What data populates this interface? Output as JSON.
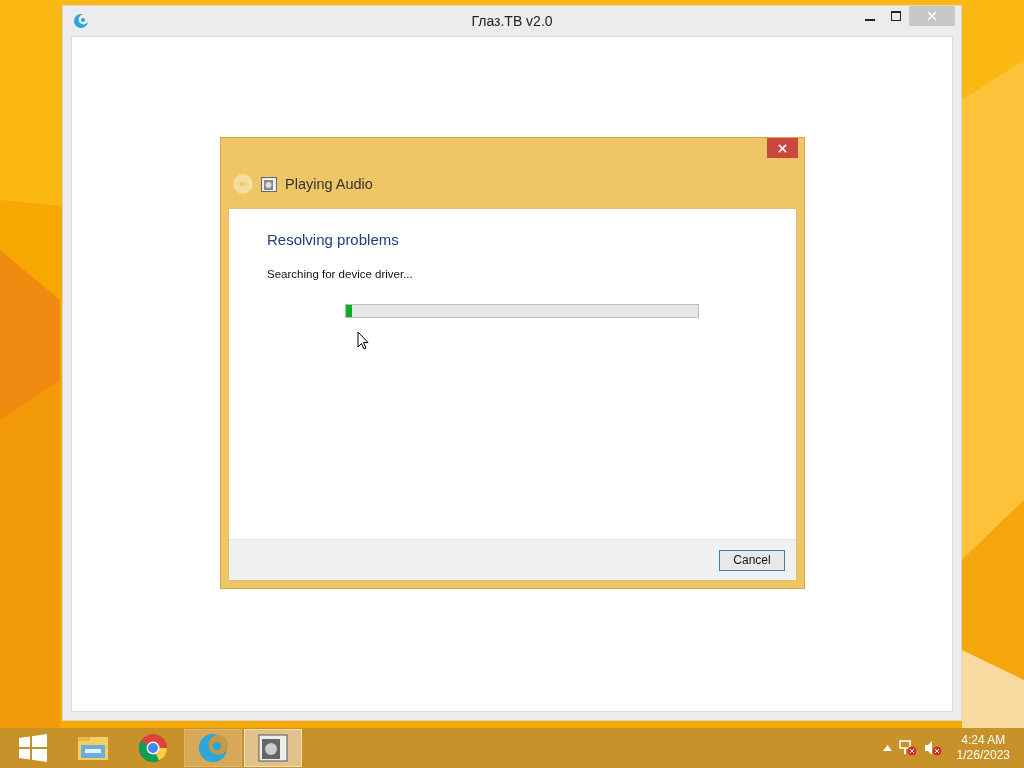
{
  "app_window": {
    "title": "Глаз.ТВ v2.0"
  },
  "dialog": {
    "title": "Playing Audio",
    "heading": "Resolving problems",
    "status": "Searching for device driver...",
    "progress": {
      "level": 0.018
    },
    "buttons": [
      {
        "label": "Cancel"
      }
    ]
  },
  "taskbar": {
    "items": [
      {
        "kind": "start",
        "selected": false
      },
      {
        "kind": "folder",
        "selected": false
      },
      {
        "kind": "chrome",
        "selected": false
      },
      {
        "kind": "app",
        "selected": false
      },
      {
        "kind": "troubleshooter",
        "selected": true
      }
    ],
    "clock": {
      "time": "4:24 AM",
      "date": "1/26/2023"
    }
  }
}
